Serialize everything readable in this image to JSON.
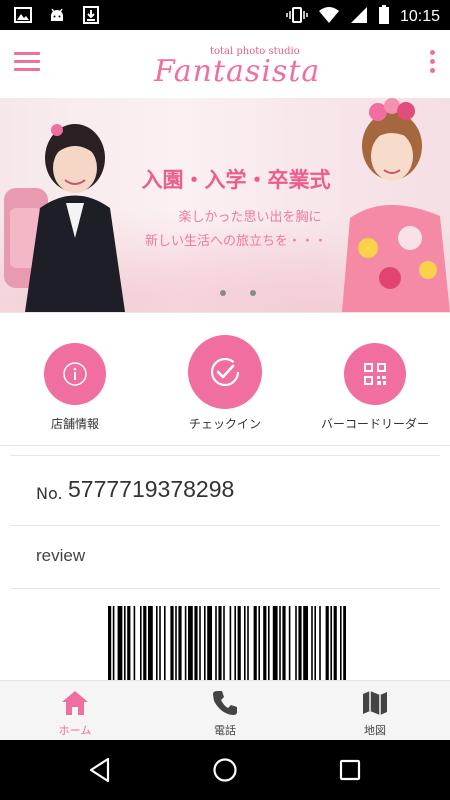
{
  "status_bar": {
    "time": "10:15",
    "left_icons": [
      "image-icon",
      "android-icon",
      "download-icon"
    ],
    "right_icons": [
      "vibrate-icon",
      "wifi-icon",
      "signal-icon",
      "battery-icon"
    ]
  },
  "app_bar": {
    "logo_small": "total photo studio",
    "logo_main": "Fantasista"
  },
  "banner": {
    "title": "入園・入学・卒業式",
    "subtitle_line1": "楽しかった思い出を胸に",
    "subtitle_line2": "新しい生活への旅立ちを・・・",
    "page_count": 2
  },
  "actions": [
    {
      "label": "店舗情報",
      "icon": "info-icon"
    },
    {
      "label": "チェックイン",
      "icon": "checkmark-icon"
    },
    {
      "label": "バーコードリーダー",
      "icon": "qrcode-icon"
    }
  ],
  "member": {
    "no_label": "No.",
    "number": "5777719378298",
    "review": "review"
  },
  "bottom_nav": [
    {
      "label": "ホーム",
      "icon": "home-icon",
      "active": true
    },
    {
      "label": "電話",
      "icon": "phone-icon",
      "active": false
    },
    {
      "label": "地図",
      "icon": "map-icon",
      "active": false
    }
  ],
  "colors": {
    "accent": "#f06ea0",
    "status_bar": "#000000",
    "nav_inactive": "#444444"
  }
}
